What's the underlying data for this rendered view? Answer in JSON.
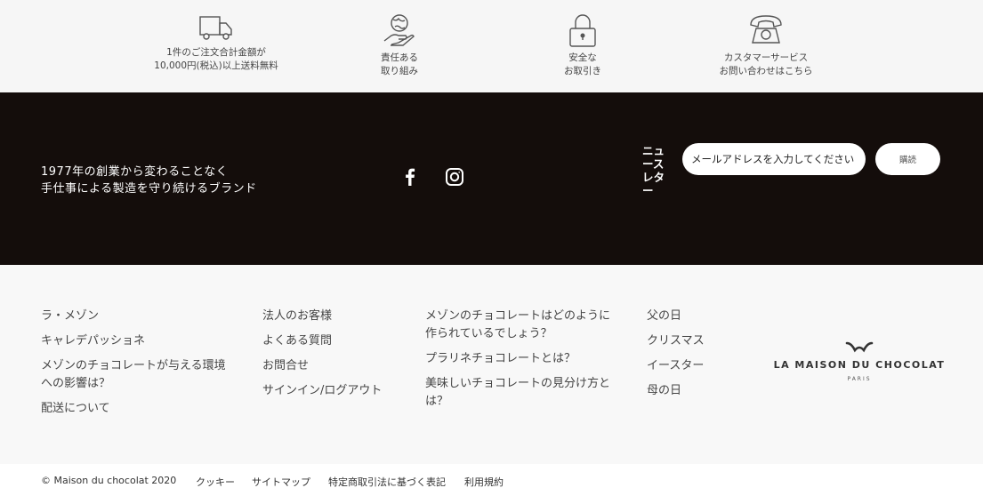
{
  "features": [
    {
      "icon": "truck-icon",
      "line1": "1件のご注文合計金額が",
      "line2": "10,000円(税込)以上送料無料"
    },
    {
      "icon": "globe-hand-icon",
      "line1": "責任ある",
      "line2": "取り組み"
    },
    {
      "icon": "padlock-icon",
      "line1": "安全な",
      "line2": "お取引き"
    },
    {
      "icon": "telephone-icon",
      "line1": "カスタマーサービス",
      "line2": "お問い合わせはこちら"
    }
  ],
  "band": {
    "tagline1": "1977年の創業から変わることなく",
    "tagline2": "手仕事による製造を守り続けるブランド",
    "social": [
      "facebook-icon",
      "instagram-icon"
    ],
    "newsletter_label": "ニュースレター",
    "email_placeholder": "メールアドレスを入力してください",
    "subscribe_label": "購読"
  },
  "links": {
    "col1": [
      "ラ・メゾン",
      "キャレデパッショネ",
      "メゾンのチョコレートが与える環境への影響は？",
      "配送について"
    ],
    "col2": [
      "法人のお客様",
      "よくある質問",
      "お問合せ",
      "サインイン/ログアウト"
    ],
    "col3": [
      "メゾンのチョコレートはどのように作られているでしょう？",
      "プラリネチョコレートとは？",
      "美味しいチョコレートの見分け方とは？"
    ],
    "col4": [
      "父の日",
      "クリスマス",
      "イースター",
      "母の日"
    ]
  },
  "logo": {
    "name": "LA MAISON DU CHOCOLAT",
    "city": "PARIS"
  },
  "bottom": {
    "copyright": "© Maison du chocolat 2020",
    "items": [
      "クッキー",
      "サイトマップ",
      "特定商取引法に基づく表記",
      "利用規約"
    ]
  }
}
